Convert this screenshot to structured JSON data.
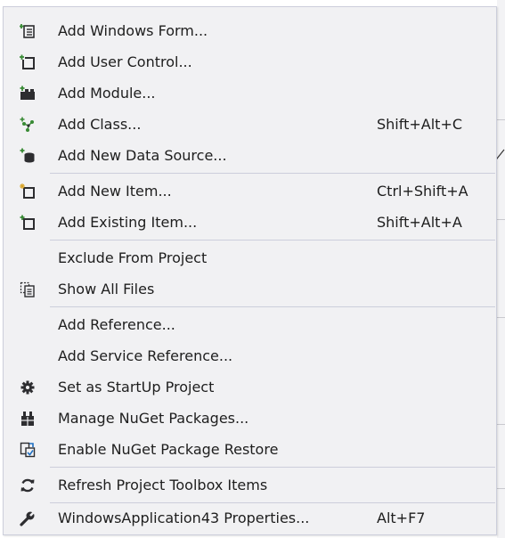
{
  "context_menu": {
    "items": [
      {
        "label": "Add Windows Form...",
        "shortcut": "",
        "icon": "add-windows-form-icon"
      },
      {
        "label": "Add User Control...",
        "shortcut": "",
        "icon": "add-user-control-icon"
      },
      {
        "label": "Add Module...",
        "shortcut": "",
        "icon": "add-module-icon"
      },
      {
        "label": "Add Class...",
        "shortcut": "Shift+Alt+C",
        "icon": "add-class-icon"
      },
      {
        "label": "Add New Data Source...",
        "shortcut": "",
        "icon": "add-data-source-icon"
      },
      {
        "label": "Add New Item...",
        "shortcut": "Ctrl+Shift+A",
        "icon": "add-new-item-icon"
      },
      {
        "label": "Add Existing Item...",
        "shortcut": "Shift+Alt+A",
        "icon": "add-existing-item-icon"
      },
      {
        "label": "Exclude From Project",
        "shortcut": "",
        "icon": ""
      },
      {
        "label": "Show All Files",
        "shortcut": "",
        "icon": "show-all-files-icon"
      },
      {
        "label": "Add Reference...",
        "shortcut": "",
        "icon": ""
      },
      {
        "label": "Add Service Reference...",
        "shortcut": "",
        "icon": ""
      },
      {
        "label": "Set as StartUp Project",
        "shortcut": "",
        "icon": "gear-icon"
      },
      {
        "label": "Manage NuGet Packages...",
        "shortcut": "",
        "icon": "nuget-package-icon"
      },
      {
        "label": "Enable NuGet Package Restore",
        "shortcut": "",
        "icon": "package-restore-icon"
      },
      {
        "label": "Refresh Project Toolbox Items",
        "shortcut": "",
        "icon": "refresh-icon"
      },
      {
        "label": "WindowsApplication43 Properties...",
        "shortcut": "Alt+F7",
        "icon": "wrench-icon"
      }
    ]
  },
  "colors": {
    "menu_background": "#f1f1f3",
    "menu_border": "#cccedb",
    "text": "#1e1e1e",
    "icon_dark": "#2d2d30",
    "icon_green": "#388a34"
  }
}
